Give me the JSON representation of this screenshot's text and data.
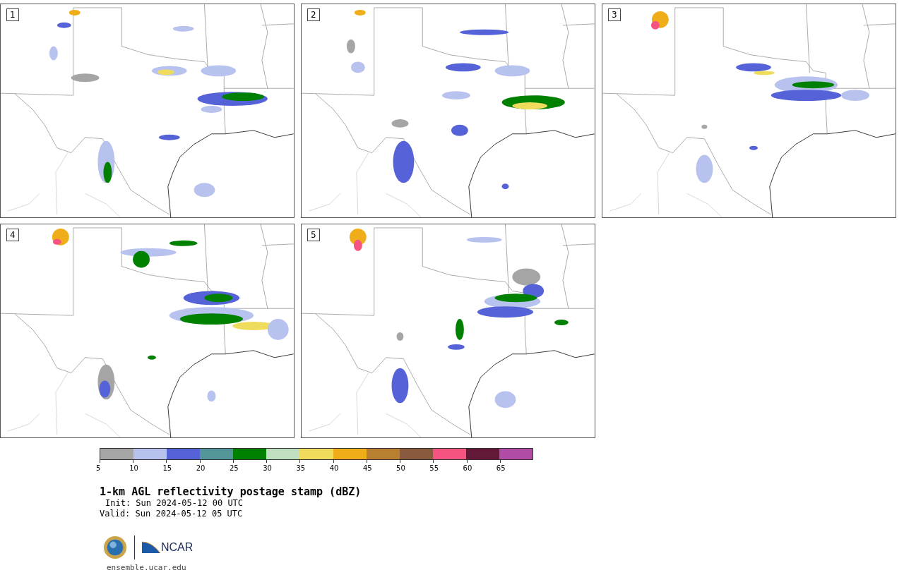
{
  "panels": [
    {
      "label": "1"
    },
    {
      "label": "2"
    },
    {
      "label": "3"
    },
    {
      "label": "4"
    },
    {
      "label": "5"
    }
  ],
  "colorbar": {
    "bins": [
      {
        "color": "#a5a5a5"
      },
      {
        "color": "#b8c2ef"
      },
      {
        "color": "#5663d8"
      },
      {
        "color": "#52969a"
      },
      {
        "color": "#008000"
      },
      {
        "color": "#c0dfc0"
      },
      {
        "color": "#f0dc5c"
      },
      {
        "color": "#f0ad1a"
      },
      {
        "color": "#b97f30"
      },
      {
        "color": "#8a5a3e"
      },
      {
        "color": "#f55480"
      },
      {
        "color": "#631837"
      },
      {
        "color": "#b04ca6"
      }
    ],
    "ticks": [
      "5",
      "10",
      "15",
      "20",
      "25",
      "30",
      "35",
      "40",
      "45",
      "50",
      "55",
      "60",
      "65"
    ]
  },
  "title": "1-km AGL reflectivity postage stamp (dBZ)",
  "init": "Init: Sun 2024-05-12 00 UTC",
  "valid": "Valid: Sun 2024-05-12 05 UTC",
  "logo_text": "NCAR",
  "footer_url": "ensemble.ucar.edu"
}
